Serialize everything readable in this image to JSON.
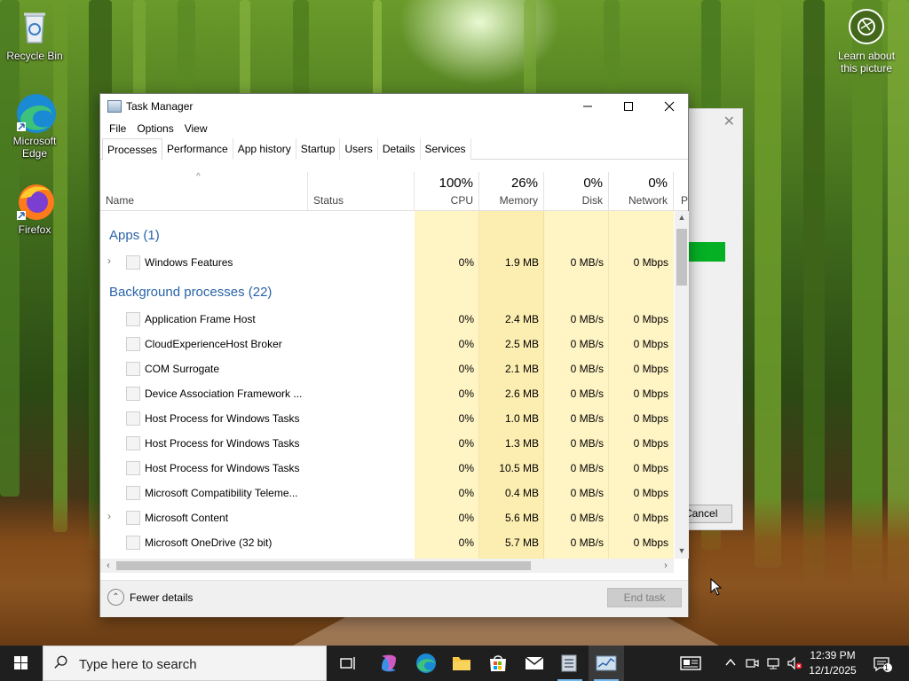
{
  "desktop": {
    "icons": [
      {
        "label": "Recycle Bin"
      },
      {
        "label": "Microsoft Edge"
      },
      {
        "label": "Firefox"
      }
    ],
    "learn_label": "Learn about this picture"
  },
  "bg_dialog": {
    "close_glyph": "✕",
    "cancel_label": "Cancel"
  },
  "task_manager": {
    "title": "Task Manager",
    "menu": [
      "File",
      "Options",
      "View"
    ],
    "tabs": [
      "Processes",
      "Performance",
      "App history",
      "Startup",
      "Users",
      "Details",
      "Services"
    ],
    "active_tab": "Processes",
    "columns": {
      "name": "Name",
      "status": "Status",
      "cpu": {
        "pct": "100%",
        "label": "CPU"
      },
      "memory": {
        "pct": "26%",
        "label": "Memory"
      },
      "disk": {
        "pct": "0%",
        "label": "Disk"
      },
      "network": {
        "pct": "0%",
        "label": "Network"
      },
      "power_partial": "P"
    },
    "groups": {
      "apps": "Apps (1)",
      "background": "Background processes (22)"
    },
    "apps": [
      {
        "name": "Windows Features",
        "cpu": "0%",
        "memory": "1.9 MB",
        "disk": "0 MB/s",
        "network": "0 Mbps",
        "expandable": true
      }
    ],
    "background": [
      {
        "name": "Application Frame Host",
        "cpu": "0%",
        "memory": "2.4 MB",
        "disk": "0 MB/s",
        "network": "0 Mbps",
        "expandable": false
      },
      {
        "name": "CloudExperienceHost Broker",
        "cpu": "0%",
        "memory": "2.5 MB",
        "disk": "0 MB/s",
        "network": "0 Mbps",
        "expandable": false
      },
      {
        "name": "COM Surrogate",
        "cpu": "0%",
        "memory": "2.1 MB",
        "disk": "0 MB/s",
        "network": "0 Mbps",
        "expandable": false
      },
      {
        "name": "Device Association Framework ...",
        "cpu": "0%",
        "memory": "2.6 MB",
        "disk": "0 MB/s",
        "network": "0 Mbps",
        "expandable": false
      },
      {
        "name": "Host Process for Windows Tasks",
        "cpu": "0%",
        "memory": "1.0 MB",
        "disk": "0 MB/s",
        "network": "0 Mbps",
        "expandable": false
      },
      {
        "name": "Host Process for Windows Tasks",
        "cpu": "0%",
        "memory": "1.3 MB",
        "disk": "0 MB/s",
        "network": "0 Mbps",
        "expandable": false
      },
      {
        "name": "Host Process for Windows Tasks",
        "cpu": "0%",
        "memory": "10.5 MB",
        "disk": "0 MB/s",
        "network": "0 Mbps",
        "expandable": false
      },
      {
        "name": "Microsoft Compatibility Teleme...",
        "cpu": "0%",
        "memory": "0.4 MB",
        "disk": "0 MB/s",
        "network": "0 Mbps",
        "expandable": false
      },
      {
        "name": "Microsoft Content",
        "cpu": "0%",
        "memory": "5.6 MB",
        "disk": "0 MB/s",
        "network": "0 Mbps",
        "expandable": true
      },
      {
        "name": "Microsoft OneDrive (32 bit)",
        "cpu": "0%",
        "memory": "5.7 MB",
        "disk": "0 MB/s",
        "network": "0 Mbps",
        "expandable": false
      }
    ],
    "footer": {
      "fewer_details": "Fewer details",
      "end_task": "End task"
    }
  },
  "taskbar": {
    "search_placeholder": "Type here to search",
    "time": "12:39 PM",
    "date": "12/1/2025",
    "notification_count": "1"
  },
  "colors": {
    "accent_blue": "#2a64a8",
    "heat_light": "#fff4c4",
    "heat_mid": "#fcedb0",
    "progress_green": "#06b025"
  }
}
